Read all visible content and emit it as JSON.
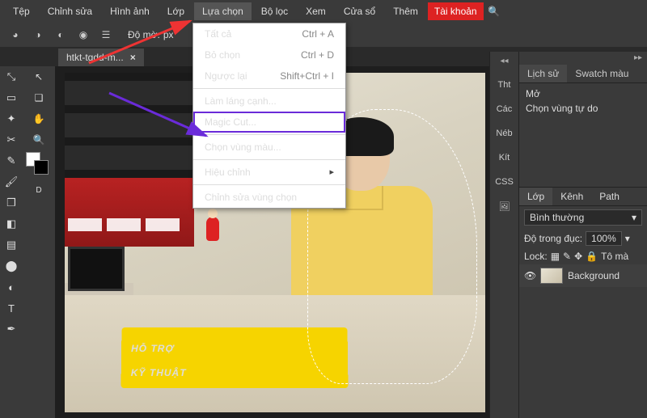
{
  "menubar": {
    "items": [
      "Tệp",
      "Chỉnh sửa",
      "Hình ảnh",
      "Lớp",
      "Lựa chọn",
      "Bộ lọc",
      "Xem",
      "Cửa sổ",
      "Thêm"
    ],
    "account": "Tài khoản"
  },
  "toolbar": {
    "opacity_label": "Độ mờ:",
    "opacity_value": "px"
  },
  "document": {
    "tab_title": "htkt-tgdd-m..."
  },
  "dropdown": {
    "items": [
      {
        "label": "Tất cả",
        "shortcut": "Ctrl + A"
      },
      {
        "label": "Bỏ chọn",
        "shortcut": "Ctrl + D"
      },
      {
        "label": "Ngược lại",
        "shortcut": "Shift+Ctrl + I"
      },
      {
        "label": "Làm láng cạnh...",
        "shortcut": ""
      },
      {
        "label": "Magic Cut...",
        "shortcut": ""
      },
      {
        "label": "Chọn vùng màu...",
        "shortcut": ""
      },
      {
        "label": "Hiệu chỉnh",
        "shortcut": "",
        "sub": true
      },
      {
        "label": "Chỉnh sửa vùng chọn",
        "shortcut": ""
      }
    ]
  },
  "right_strip": {
    "labels": [
      "Tht",
      "Các",
      "Néb",
      "Kít",
      "CSS"
    ]
  },
  "history_panel": {
    "tab1": "Lịch sử",
    "tab2": "Swatch màu",
    "items": [
      "Mở",
      "Chọn vùng tự do"
    ]
  },
  "layers_panel": {
    "tab1": "Lớp",
    "tab2": "Kênh",
    "tab3": "Path",
    "blend_mode": "Bình thường",
    "opacity_label": "Độ trong đục:",
    "opacity_value": "100%",
    "lock_label": "Lock:",
    "lock_extra": "Tô mà",
    "layer_name": "Background"
  },
  "canvas": {
    "sign_line1": "HỖ TRỢ",
    "sign_line2": "KỸ THUẬT"
  },
  "swatch_d": "D"
}
